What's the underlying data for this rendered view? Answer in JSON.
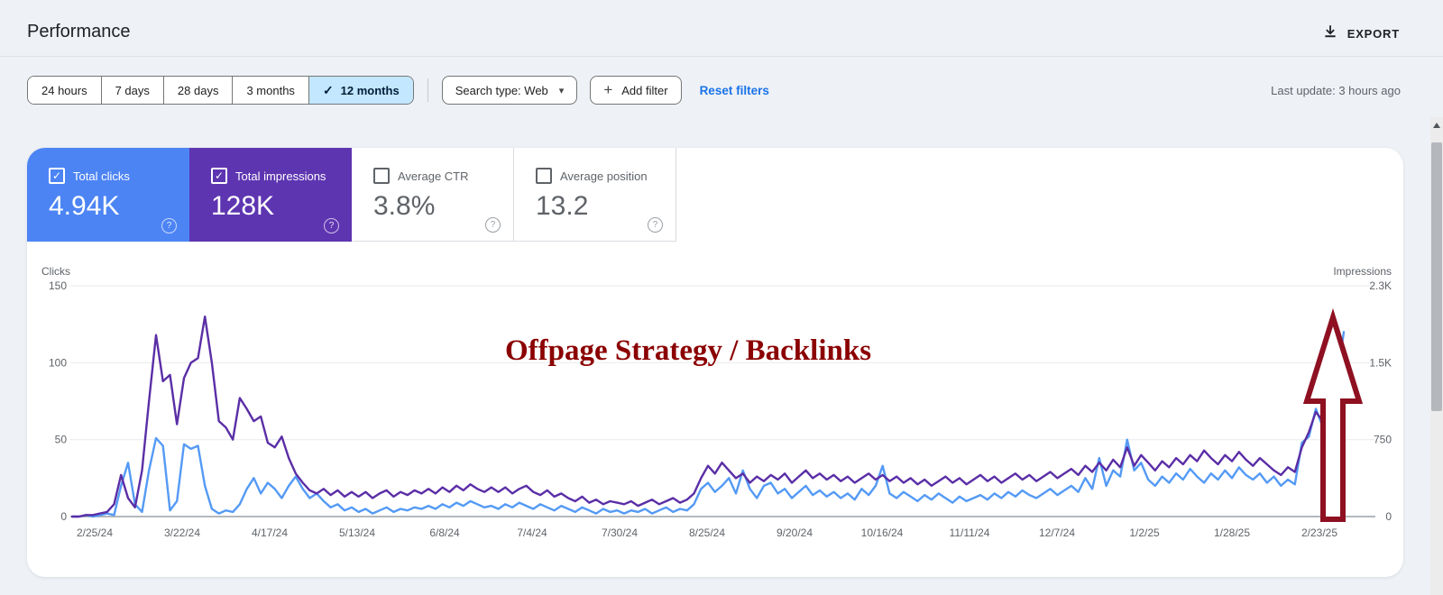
{
  "header": {
    "title": "Performance",
    "export_label": "EXPORT",
    "export_icon": "download-icon"
  },
  "filters": {
    "time_ranges": [
      {
        "label": "24 hours",
        "selected": false
      },
      {
        "label": "7 days",
        "selected": false
      },
      {
        "label": "28 days",
        "selected": false
      },
      {
        "label": "3 months",
        "selected": false
      },
      {
        "label": "12 months",
        "selected": true
      }
    ],
    "selected_check_glyph": "✓",
    "search_type_label": "Search type: Web",
    "search_type_caret": "▾",
    "add_filter_plus": "+",
    "add_filter_label": "Add filter",
    "reset_label": "Reset filters",
    "last_update": "Last update: 3 hours ago"
  },
  "metrics": [
    {
      "label": "Total clicks",
      "value": "4.94K",
      "checked": true,
      "color": "#4c84f4",
      "help_glyph": "?"
    },
    {
      "label": "Total impressions",
      "value": "128K",
      "checked": true,
      "color": "#5e35b1",
      "help_glyph": "?"
    },
    {
      "label": "Average CTR",
      "value": "3.8%",
      "checked": false,
      "color": "#ffffff",
      "help_glyph": "?"
    },
    {
      "label": "Average position",
      "value": "13.2",
      "checked": false,
      "color": "#ffffff",
      "help_glyph": "?"
    }
  ],
  "chart_data": {
    "type": "line",
    "title": "",
    "left_axis": {
      "label": "Clicks",
      "ticks": [
        "150",
        "100",
        "50",
        "0"
      ],
      "ylim": [
        0,
        150
      ]
    },
    "right_axis": {
      "label": "Impressions",
      "ticks": [
        "2.3K",
        "1.5K",
        "750",
        "0"
      ],
      "ylim": [
        0,
        2300
      ]
    },
    "x_labels": [
      "2/25/24",
      "3/22/24",
      "4/17/24",
      "5/13/24",
      "6/8/24",
      "7/4/24",
      "7/30/24",
      "8/25/24",
      "9/20/24",
      "10/16/24",
      "11/11/24",
      "12/7/24",
      "1/2/25",
      "1/28/25",
      "2/23/25"
    ],
    "grid": true,
    "legend_position": "none",
    "annotation": {
      "text": "Offpage Strategy / Backlinks",
      "color": "#8b0000",
      "arrow_color": "#8e1021"
    },
    "series": [
      {
        "name": "Total clicks",
        "axis": "left",
        "color": "#549af5",
        "values": [
          0,
          0,
          1,
          0,
          1,
          2,
          1,
          20,
          35,
          8,
          3,
          30,
          51,
          46,
          4,
          10,
          47,
          44,
          46,
          20,
          5,
          2,
          4,
          3,
          8,
          18,
          25,
          15,
          22,
          18,
          12,
          20,
          26,
          18,
          12,
          15,
          10,
          6,
          8,
          4,
          6,
          3,
          5,
          2,
          4,
          6,
          3,
          5,
          4,
          6,
          5,
          7,
          5,
          8,
          6,
          9,
          7,
          10,
          8,
          6,
          7,
          5,
          8,
          6,
          9,
          7,
          5,
          8,
          6,
          4,
          7,
          5,
          3,
          6,
          4,
          2,
          5,
          3,
          4,
          2,
          4,
          3,
          5,
          2,
          4,
          6,
          3,
          5,
          4,
          8,
          18,
          22,
          16,
          20,
          25,
          15,
          30,
          18,
          12,
          20,
          22,
          15,
          18,
          12,
          16,
          20,
          14,
          17,
          13,
          16,
          12,
          15,
          11,
          18,
          14,
          20,
          33,
          15,
          12,
          16,
          13,
          10,
          14,
          11,
          15,
          12,
          9,
          13,
          10,
          12,
          14,
          11,
          15,
          12,
          16,
          13,
          17,
          14,
          12,
          15,
          18,
          14,
          17,
          20,
          16,
          25,
          18,
          38,
          20,
          30,
          26,
          50,
          30,
          35,
          24,
          20,
          26,
          22,
          28,
          24,
          31,
          26,
          22,
          28,
          24,
          30,
          25,
          32,
          27,
          24,
          28,
          22,
          26,
          20,
          24,
          21,
          48,
          52,
          70,
          58,
          92,
          88,
          120
        ]
      },
      {
        "name": "Total impressions",
        "axis": "right",
        "color": "#5a2ea6",
        "values": [
          0,
          0,
          15,
          15,
          31,
          46,
          123,
          414,
          184,
          92,
          460,
          1150,
          1809,
          1349,
          1411,
          920,
          1380,
          1533,
          1579,
          1993,
          1533,
          951,
          889,
          767,
          1181,
          1073,
          951,
          997,
          736,
          690,
          797,
          583,
          429,
          337,
          261,
          230,
          276,
          215,
          261,
          199,
          245,
          199,
          245,
          184,
          230,
          261,
          199,
          245,
          215,
          261,
          230,
          276,
          230,
          291,
          245,
          307,
          261,
          322,
          276,
          245,
          291,
          245,
          291,
          230,
          276,
          307,
          245,
          215,
          261,
          199,
          230,
          184,
          153,
          199,
          138,
          169,
          123,
          153,
          138,
          123,
          153,
          107,
          138,
          169,
          123,
          153,
          184,
          138,
          169,
          230,
          383,
          506,
          429,
          537,
          460,
          383,
          429,
          337,
          399,
          353,
          414,
          368,
          429,
          337,
          399,
          460,
          383,
          429,
          368,
          414,
          353,
          399,
          337,
          383,
          429,
          368,
          414,
          353,
          399,
          337,
          383,
          322,
          368,
          307,
          353,
          399,
          337,
          383,
          322,
          368,
          414,
          353,
          399,
          337,
          383,
          429,
          368,
          414,
          353,
          399,
          445,
          383,
          429,
          475,
          414,
          506,
          445,
          537,
          460,
          567,
          491,
          690,
          506,
          613,
          537,
          460,
          552,
          491,
          583,
          521,
          613,
          552,
          659,
          583,
          521,
          613,
          552,
          644,
          567,
          506,
          583,
          521,
          460,
          414,
          491,
          445,
          690,
          843,
          1043,
          951,
          1349,
          1533,
          1456
        ]
      }
    ]
  }
}
